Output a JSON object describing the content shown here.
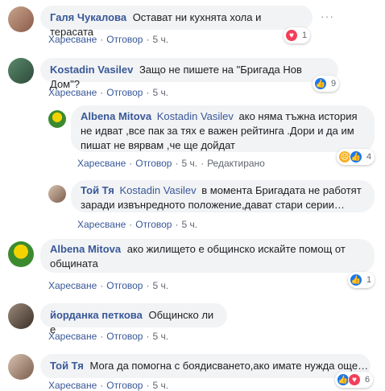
{
  "comments": [
    {
      "author": "Галя Чукалова",
      "mention": "",
      "text": "Остават ни кухнята хола и терасата",
      "actions": {
        "like": "Харесване",
        "reply": "Отговор",
        "time": "5 ч.",
        "edited": ""
      },
      "reactions": {
        "icons": [
          "love-icon"
        ],
        "count": "1"
      }
    },
    {
      "author": "Kostadin Vasilev",
      "mention": "",
      "text": "Защо не пишете на \"Бригада Нов Дом\"?",
      "actions": {
        "like": "Харесване",
        "reply": "Отговор",
        "time": "5 ч.",
        "edited": ""
      },
      "reactions": {
        "icons": [
          "like-icon"
        ],
        "count": "9"
      }
    },
    {
      "author": "Albena Mitova",
      "mention": "Kostadin Vasilev",
      "text": "ако няма тъжна история не идват ,все пак за тях е важен рейтинга .Дори и да им пишат не вярвам ,че ще дойдат",
      "actions": {
        "like": "Харесване",
        "reply": "Отговор",
        "time": "5 ч.",
        "edited": "Редактирано"
      },
      "reactions": {
        "icons": [
          "sad-icon",
          "like-icon"
        ],
        "count": "4"
      }
    },
    {
      "author": "Той Тя",
      "mention": "Kostadin Vasilev",
      "text": "в момента Бригадата не работят заради извънредното положение,дават стари серии…",
      "actions": {
        "like": "Харесване",
        "reply": "Отговор",
        "time": "5 ч.",
        "edited": ""
      },
      "reactions": {
        "icons": [],
        "count": ""
      }
    },
    {
      "author": "Albena Mitova",
      "mention": "",
      "text": "ако жилището е общинско искайте помощ от общината",
      "actions": {
        "like": "Харесване",
        "reply": "Отговор",
        "time": "5 ч.",
        "edited": ""
      },
      "reactions": {
        "icons": [
          "like-icon"
        ],
        "count": "1"
      }
    },
    {
      "author": "йорданка петкова",
      "mention": "",
      "text": "Общинско ли е",
      "actions": {
        "like": "Харесване",
        "reply": "Отговор",
        "time": "5 ч.",
        "edited": ""
      },
      "reactions": {
        "icons": [],
        "count": ""
      }
    },
    {
      "author": "Той Тя",
      "mention": "",
      "text": "Мога да помогна с боядисването,ако имате нужда още…",
      "actions": {
        "like": "Харесване",
        "reply": "Отговор",
        "time": "5 ч.",
        "edited": ""
      },
      "reactions": {
        "icons": [
          "like-icon",
          "love-icon"
        ],
        "count": "6"
      }
    }
  ]
}
